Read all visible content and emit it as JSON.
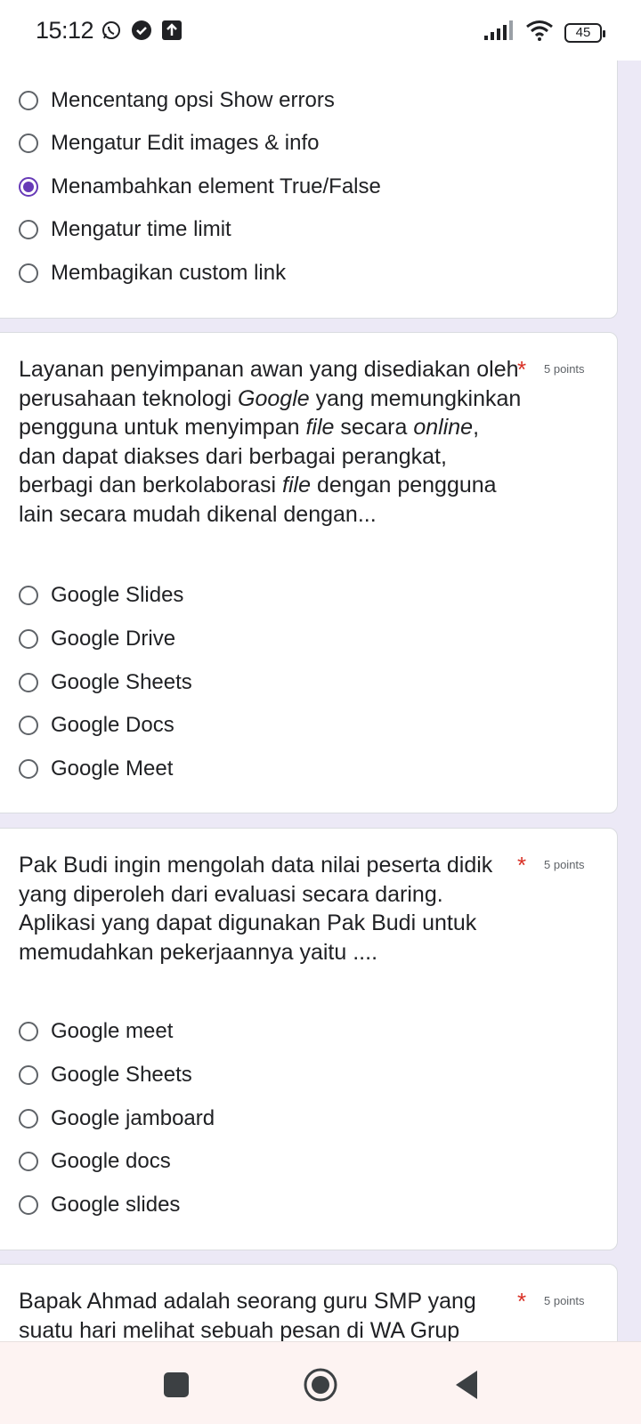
{
  "status_bar": {
    "time": "15:12",
    "battery": "45",
    "icons": [
      "whatsapp-icon",
      "check-circle-icon",
      "upload-icon",
      "signal-icon",
      "wifi-icon",
      "battery-icon"
    ]
  },
  "question_prev": {
    "options": [
      {
        "label": "Mencentang opsi Show errors",
        "checked": false
      },
      {
        "label": "Mengatur Edit images & info",
        "checked": false
      },
      {
        "label": "Menambahkan element True/False",
        "checked": true
      },
      {
        "label": "Mengatur time limit",
        "checked": false
      },
      {
        "label": "Membagikan custom link",
        "checked": false
      }
    ]
  },
  "question_drive": {
    "text_parts": {
      "p1": "Layanan penyimpanan awan yang disediakan oleh perusahaan teknologi ",
      "google": "Google",
      "p2": " yang memungkinkan pengguna untuk menyimpan ",
      "file1": "file",
      "p3": " secara ",
      "online": "online",
      "p4": ", dan dapat diakses dari berbagai perangkat,  berbagi  dan berkolaborasi ",
      "file2": "file",
      "p5": " dengan pengguna lain secara mudah dikenal dengan..."
    },
    "required": "*",
    "points": "5 points",
    "options": [
      {
        "label": "Google Slides"
      },
      {
        "label": "Google Drive"
      },
      {
        "label": "Google Sheets"
      },
      {
        "label": "Google Docs"
      },
      {
        "label": "Google Meet"
      }
    ]
  },
  "question_pakbudi": {
    "text": "Pak Budi ingin mengolah data nilai peserta didik yang diperoleh dari evaluasi secara daring. Aplikasi yang dapat digunakan Pak Budi untuk memudahkan pekerjaannya yaitu ....",
    "required": "*",
    "points": "5 points",
    "options": [
      {
        "label": "Google meet"
      },
      {
        "label": "Google Sheets"
      },
      {
        "label": "Google jamboard"
      },
      {
        "label": "Google docs"
      },
      {
        "label": "Google slides"
      }
    ]
  },
  "question_ahmad": {
    "text": "Bapak Ahmad adalah seorang guru SMP yang suatu hari melihat sebuah pesan di WA Grup",
    "required": "*",
    "points": "5 points"
  },
  "nav_bar": {
    "buttons": [
      "recents-button",
      "home-button",
      "back-button"
    ]
  }
}
